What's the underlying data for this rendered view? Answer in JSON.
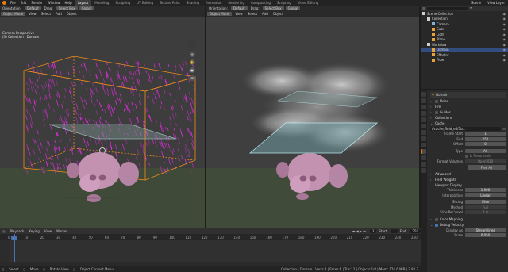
{
  "menubar": {
    "menus": [
      "File",
      "Edit",
      "Render",
      "Window",
      "Help"
    ],
    "workspaces": [
      "Layout",
      "Modeling",
      "Sculpting",
      "UV Editing",
      "Texture Paint",
      "Shading",
      "Animation",
      "Rendering",
      "Compositing",
      "Scripting",
      "Video Editing"
    ],
    "active_workspace": "Layout",
    "scene": "Scene",
    "view_layer": "View Layer"
  },
  "viewport_left": {
    "header_row1": [
      "Orientation:",
      "Default",
      "Drag:",
      "Select Box",
      "Global"
    ],
    "header_row2": [
      "Object Mode",
      "View",
      "Select",
      "Add",
      "Object"
    ],
    "caption_line1": "Camera Perspective",
    "caption_line2": "(3) Collection | Domain"
  },
  "viewport_right": {
    "header_row1": [
      "Orientation:",
      "Default",
      "Drag:",
      "Select Box",
      "Global"
    ],
    "header_row2": [
      "Object Mode",
      "View",
      "Select",
      "Add",
      "Object"
    ]
  },
  "outliner": {
    "items": [
      {
        "label": "Scene Collection",
        "indent": 0,
        "icon": "scene-icon",
        "color": "#cfcfcf",
        "selected": false
      },
      {
        "label": "Collection",
        "indent": 1,
        "icon": "collection-icon",
        "color": "#cfcfcf",
        "selected": false
      },
      {
        "label": "Camera",
        "indent": 2,
        "icon": "camera-icon",
        "color": "#7fb0e0",
        "selected": false
      },
      {
        "label": "Cube",
        "indent": 2,
        "icon": "mesh-icon",
        "color": "#e8a33b",
        "selected": false
      },
      {
        "label": "Light",
        "indent": 2,
        "icon": "light-icon",
        "color": "#e8a33b",
        "selected": false
      },
      {
        "label": "Plane",
        "indent": 2,
        "icon": "mesh-icon",
        "color": "#e8a33b",
        "selected": false
      },
      {
        "label": "Workflow",
        "indent": 1,
        "icon": "collection-icon",
        "color": "#cfcfcf",
        "selected": false
      },
      {
        "label": "Domain",
        "indent": 2,
        "icon": "mesh-icon",
        "color": "#e8a33b",
        "selected": true
      },
      {
        "label": "Effector",
        "indent": 2,
        "icon": "mesh-icon",
        "color": "#e8a33b",
        "selected": false
      },
      {
        "label": "Flow",
        "indent": 2,
        "icon": "mesh-icon",
        "color": "#e8a33b",
        "selected": false
      }
    ]
  },
  "properties": {
    "object_name": "Domain",
    "panels_top": [
      "Noise",
      "Fire",
      "Guides",
      "Collections",
      "Cache"
    ],
    "cache_path": "//cache_fluid_e0f3b...",
    "frame_start_label": "Frame Start",
    "frame_start": "1",
    "end_label": "End",
    "end": "250",
    "offset_label": "Offset",
    "offset": "0",
    "type_label": "Type",
    "type": "All",
    "is_resumable": "Is Resumable",
    "format_volumes_label": "Format Volumes",
    "format_volumes": "OpenVDB",
    "free_all": "Free All",
    "panels_mid": [
      "Advanced",
      "Field Weights",
      "Viewport Display"
    ],
    "thickness_label": "Thickness",
    "thickness": "1.000",
    "interpolation_label": "Interpolation",
    "interpolation": "Linear",
    "slicing_label": "Slicing",
    "slicing": "Slice",
    "method_label": "Method",
    "method": "Full",
    "slice_per_voxel_label": "Slice Per Voxel",
    "slice_per_voxel": "1.0",
    "color_mapping": "Color Mapping",
    "debug_velocity": "Debug Velocity",
    "display_as_label": "Display As",
    "display_as": "Streamlines",
    "scale_label": "Scale",
    "scale": "0.050"
  },
  "timeline": {
    "header": [
      "Playback",
      "Keying",
      "View",
      "Marker"
    ],
    "current_frame": "3",
    "start_label": "Start",
    "start": "1",
    "end_label": "End",
    "end": "250",
    "ruler_marks": [
      "0",
      "10",
      "20",
      "30",
      "40",
      "50",
      "60",
      "70",
      "80",
      "90",
      "100",
      "110",
      "120",
      "130",
      "140",
      "150",
      "160",
      "170",
      "180",
      "190",
      "200",
      "210",
      "220",
      "230",
      "240",
      "250"
    ]
  },
  "statusbar": {
    "items": [
      "Select",
      "Move",
      "Rotate View",
      "Object Context Menu"
    ],
    "version": "Collection | Domain | Verts:8 | Faces:6 | Tris:12 | Objects:1/8 | Mem: 174.6 MiB | 2.82.7"
  },
  "colors": {
    "accent": "#e87d0d",
    "selection": "#4772b3",
    "velocity": "#ff29ff"
  }
}
